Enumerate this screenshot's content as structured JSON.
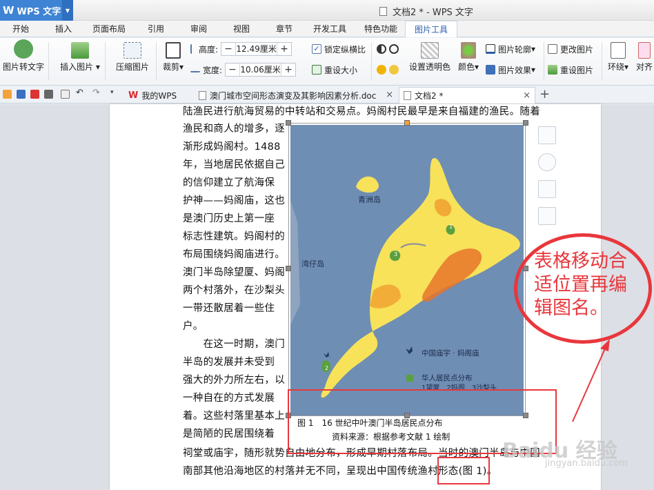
{
  "app": {
    "logo": "W",
    "name": "WPS 文字",
    "window_title": "文档2 * - WPS 文字"
  },
  "ribbon_tabs": [
    "开始",
    "插入",
    "页面布局",
    "引用",
    "审阅",
    "视图",
    "章节",
    "开发工具",
    "特色功能",
    "图片工具"
  ],
  "ribbon": {
    "img_to_text": "图片转文字",
    "insert_img": "插入图片",
    "compress": "压缩图片",
    "crop": "裁剪",
    "height_label": "高度:",
    "height_value": "12.49厘米",
    "width_label": "宽度:",
    "width_value": "10.06厘米",
    "lock_ratio": "锁定纵横比",
    "reset_size": "重设大小",
    "set_transparent": "设置透明色",
    "color": "颜色",
    "outline": "图片轮廓",
    "effect": "图片效果",
    "change_img": "更改图片",
    "reset_img": "重设图片",
    "wrap": "环绕",
    "align": "对齐"
  },
  "doc_tabs": [
    {
      "label": "我的WPS"
    },
    {
      "label": "澳门城市空间形态演变及其影响因素分析.doc"
    },
    {
      "label": "文档2 *"
    }
  ],
  "doc": {
    "lines": [
      "陆渔民进行航海贸易的中转站和交易点。妈阁村民最早是来自福建的渔民。随着",
      "渔民和商人的增多，逐",
      "渐形成妈阁村。1488",
      "年，当地居民依据自己",
      "的信仰建立了航海保",
      "护神——妈阁庙，这也",
      "是澳门历史上第一座",
      "标志性建筑。妈阁村的",
      "布局围绕妈阁庙进行。",
      "澳门半岛除望厦、妈阁",
      "两个村落外，在沙梨头",
      "一带还散居着一些住",
      "户。",
      "　　在这一时期，澳门",
      "半岛的发展并未受到",
      "强大的外力所左右，以",
      "一种自在的方式发展",
      "着。这些村落里基本上",
      "是简陋的民居围绕着",
      "祠堂或庙宇，随形就势自由地分布，形成早期村落布局。当时的澳门半岛与中国",
      "南部其他沿海地区的村落并无不同，呈现出中国传统渔村形态(图 1)。"
    ],
    "caption_line1": "图 1　16 世纪中叶澳门半岛居民点分布",
    "caption_line2": "资料来源：根据参考文献 1 绘制"
  },
  "map": {
    "label_qingzhou": "青洲岛",
    "label_wanzai": "湾仔岛",
    "legend_temple": "中国庙宇 · 妈阁庙",
    "legend_settle": "华人居民点分布",
    "legend_names": "1望厦　2妈阁　3沙梨头",
    "n1": "1",
    "n2": "2",
    "n3": "3"
  },
  "annotation": {
    "text": "表格移动合适位置再编辑图名。"
  },
  "watermark": {
    "brand": "Baidu 经验",
    "url": "jingyan.baidu.com"
  },
  "colors": {
    "accent": "#e8373c",
    "wps_blue": "#3f84d4",
    "map_water": "#6f8eb4",
    "map_land": "#f7e25a",
    "map_hot": "#e8762c"
  }
}
